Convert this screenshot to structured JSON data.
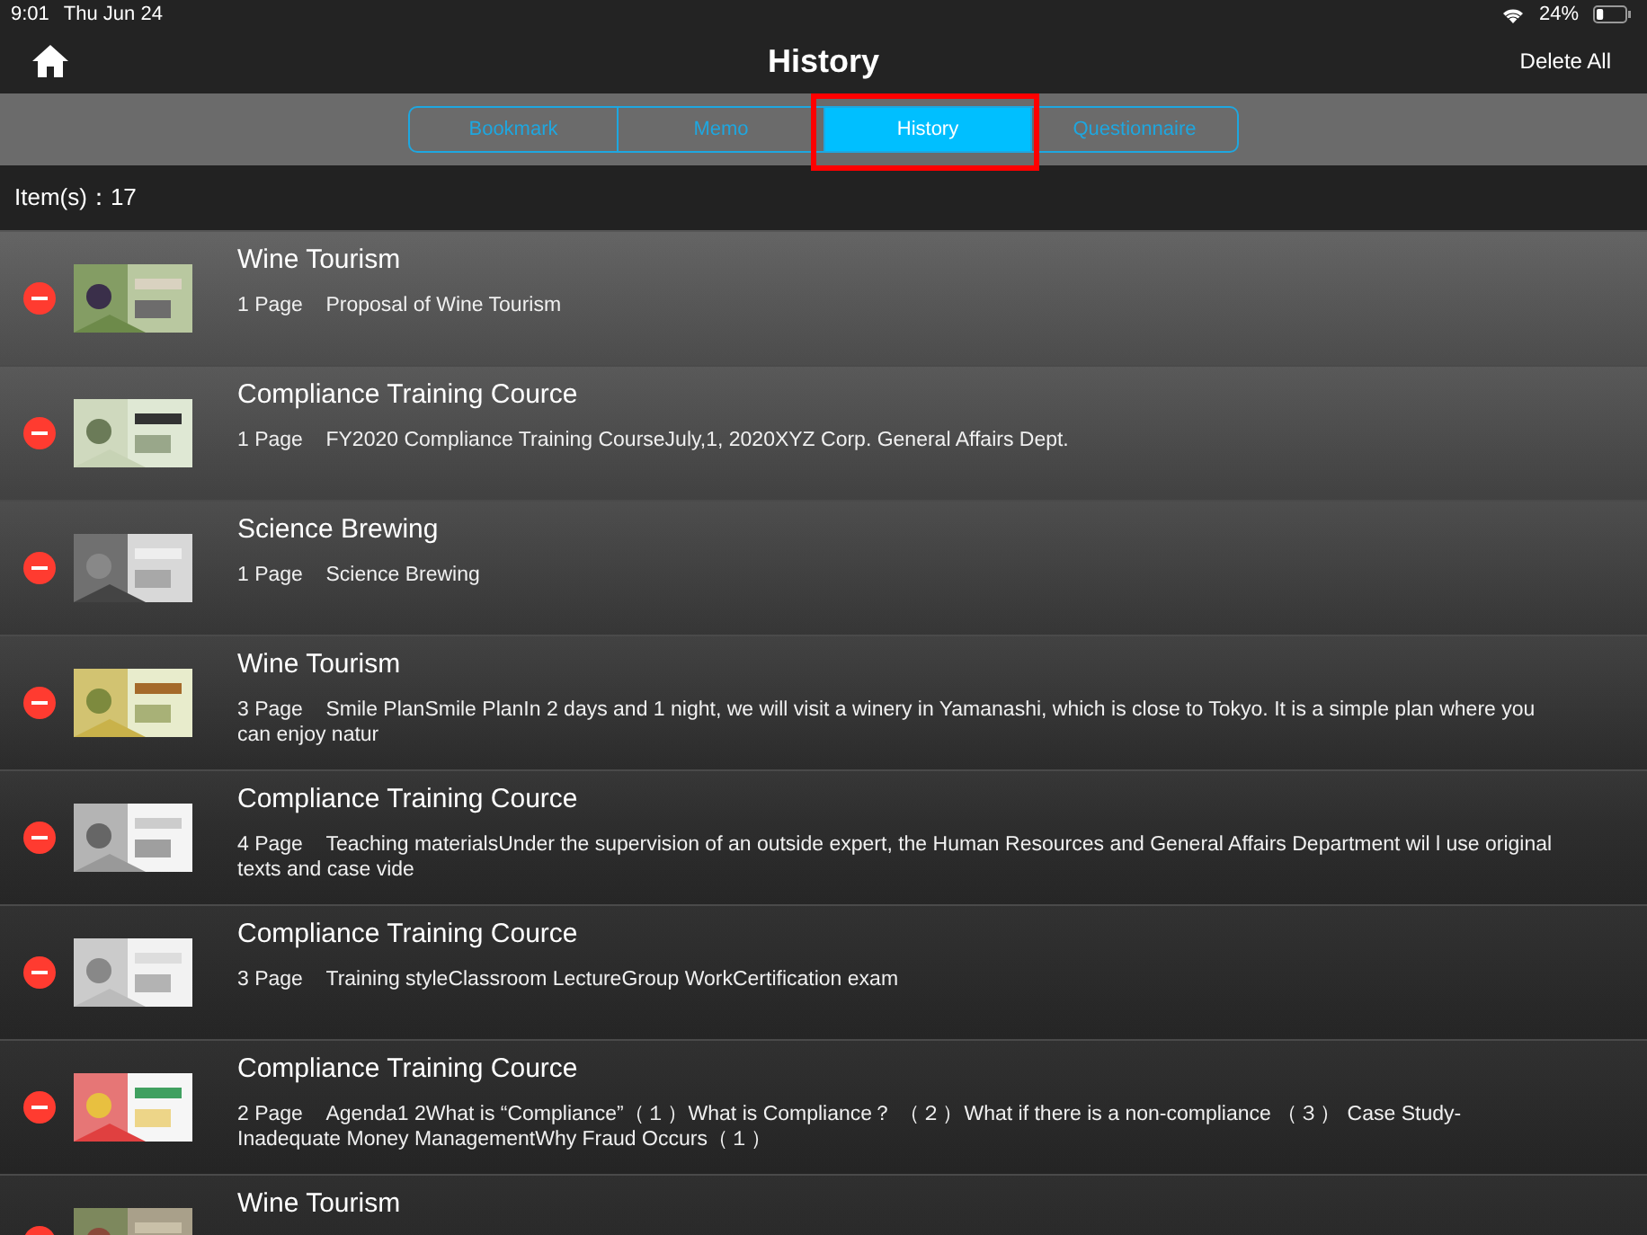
{
  "status_bar": {
    "time": "9:01",
    "date": "Thu Jun 24",
    "battery_text": "24%"
  },
  "nav_bar": {
    "title": "History",
    "action": "Delete All"
  },
  "tabs": [
    {
      "label": "Bookmark",
      "selected": false,
      "highlighted": false
    },
    {
      "label": "Memo",
      "selected": false,
      "highlighted": false
    },
    {
      "label": "History",
      "selected": true,
      "highlighted": true
    },
    {
      "label": "Questionnaire",
      "selected": false,
      "highlighted": false
    }
  ],
  "item_count": "Item(s)：17",
  "rows": [
    {
      "title": "Wine Tourism",
      "pages": "1 Page",
      "text": "Proposal of Wine Tourism"
    },
    {
      "title": "Compliance Training Cource",
      "pages": "1 Page",
      "text": "FY2020 Compliance Training CourseJuly,1, 2020XYZ Corp. General Affairs Dept."
    },
    {
      "title": "Science Brewing",
      "pages": "1 Page",
      "text": "Science Brewing"
    },
    {
      "title": "Wine Tourism",
      "pages": "3 Page",
      "text": "Smile PlanSmile PlanIn 2 days and 1 night, we will visit a winery in Yamanashi, which is close to Tokyo. It is a simple plan where you can enjoy natur"
    },
    {
      "title": "Compliance Training Cource",
      "pages": "4 Page",
      "text": "Teaching materialsUnder the supervision of an outside expert, the Human Resources and General Affairs Department wil l use original texts and case vide"
    },
    {
      "title": "Compliance Training Cource",
      "pages": "3 Page",
      "text": "Training styleClassroom LectureGroup WorkCertification exam"
    },
    {
      "title": "Compliance Training Cource",
      "pages": "2 Page",
      "text": "Agenda1 2What is “Compliance”（１）What is Compliance？ （２）What if there is a non-compliance （３） Case Study-Inadequate Money ManagementWhy Fraud Occurs（１）"
    },
    {
      "title": "Wine Tourism"
    }
  ]
}
